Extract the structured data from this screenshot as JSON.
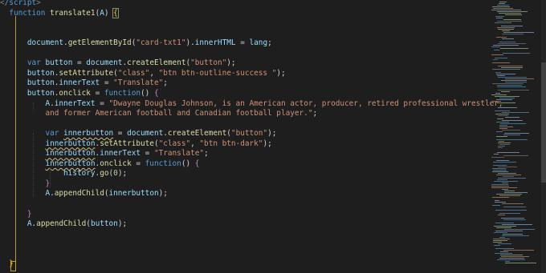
{
  "editor": {
    "lines": [
      {
        "tokens": [
          {
            "t": "<",
            "c": "t-tag"
          },
          {
            "t": "/script",
            "c": "t-tagname"
          },
          {
            "t": ">",
            "c": "t-tag"
          }
        ]
      },
      {
        "tokens": [
          {
            "t": "  "
          },
          {
            "t": "function",
            "c": "t-kw"
          },
          {
            "t": " "
          },
          {
            "t": "translate1",
            "c": "t-fn"
          },
          {
            "t": "(",
            "c": "t-punc"
          },
          {
            "t": "A",
            "c": "t-var"
          },
          {
            "t": ") "
          },
          {
            "t": "{",
            "c": "t-par1 bracket-box"
          }
        ]
      },
      {
        "tokens": []
      },
      {
        "tokens": []
      },
      {
        "tokens": [
          {
            "t": "      "
          },
          {
            "t": "document",
            "c": "t-obj"
          },
          {
            "t": "."
          },
          {
            "t": "getElementById",
            "c": "t-fn"
          },
          {
            "t": "("
          },
          {
            "t": "\"card-txt1\"",
            "c": "t-str"
          },
          {
            "t": ")."
          },
          {
            "t": "innerHTML",
            "c": "t-prop"
          },
          {
            "t": " = "
          },
          {
            "t": "lang",
            "c": "t-var"
          },
          {
            "t": ";"
          }
        ]
      },
      {
        "tokens": []
      },
      {
        "tokens": [
          {
            "t": "      "
          },
          {
            "t": "var",
            "c": "t-kw"
          },
          {
            "t": " "
          },
          {
            "t": "button",
            "c": "t-var"
          },
          {
            "t": " = "
          },
          {
            "t": "document",
            "c": "t-obj"
          },
          {
            "t": "."
          },
          {
            "t": "createElement",
            "c": "t-fn"
          },
          {
            "t": "("
          },
          {
            "t": "\"button\"",
            "c": "t-str"
          },
          {
            "t": ");"
          }
        ]
      },
      {
        "tokens": [
          {
            "t": "      "
          },
          {
            "t": "button",
            "c": "t-var"
          },
          {
            "t": "."
          },
          {
            "t": "setAttribute",
            "c": "t-fn"
          },
          {
            "t": "("
          },
          {
            "t": "\"class\"",
            "c": "t-str"
          },
          {
            "t": ", "
          },
          {
            "t": "\"btn btn-outline-success \"",
            "c": "t-str"
          },
          {
            "t": ");"
          }
        ]
      },
      {
        "tokens": [
          {
            "t": "      "
          },
          {
            "t": "button",
            "c": "t-var"
          },
          {
            "t": "."
          },
          {
            "t": "innerText",
            "c": "t-prop"
          },
          {
            "t": " = "
          },
          {
            "t": "\"Translate\"",
            "c": "t-str"
          },
          {
            "t": ";"
          }
        ]
      },
      {
        "tokens": [
          {
            "t": "      "
          },
          {
            "t": "button",
            "c": "t-var"
          },
          {
            "t": "."
          },
          {
            "t": "onclick",
            "c": "t-fn"
          },
          {
            "t": " = "
          },
          {
            "t": "function",
            "c": "t-kw"
          },
          {
            "t": "() "
          },
          {
            "t": "{",
            "c": "t-ctrl"
          }
        ]
      },
      {
        "tokens": [
          {
            "t": "          "
          },
          {
            "t": "A",
            "c": "t-var"
          },
          {
            "t": "."
          },
          {
            "t": "innerText",
            "c": "t-prop"
          },
          {
            "t": " = "
          },
          {
            "t": "\"Dwayne Douglas Johnson, is an American actor, producer, retired professional wrestler,",
            "c": "t-str"
          }
        ]
      },
      {
        "tokens": [
          {
            "t": "          "
          },
          {
            "t": "and former American football and Canadian football player.\"",
            "c": "t-str"
          },
          {
            "t": ";"
          }
        ]
      },
      {
        "tokens": []
      },
      {
        "tokens": [
          {
            "t": "          "
          },
          {
            "t": "var",
            "c": "t-kw"
          },
          {
            "t": " "
          },
          {
            "t": "innerbutton",
            "c": "t-var t-ul"
          },
          {
            "t": " = "
          },
          {
            "t": "document",
            "c": "t-obj"
          },
          {
            "t": "."
          },
          {
            "t": "createElement",
            "c": "t-fn"
          },
          {
            "t": "("
          },
          {
            "t": "\"button\"",
            "c": "t-str"
          },
          {
            "t": ");"
          }
        ]
      },
      {
        "tokens": [
          {
            "t": "          "
          },
          {
            "t": "innerbutton",
            "c": "t-var t-ul"
          },
          {
            "t": "."
          },
          {
            "t": "setAttribute",
            "c": "t-fn"
          },
          {
            "t": "("
          },
          {
            "t": "\"class\"",
            "c": "t-str"
          },
          {
            "t": ", "
          },
          {
            "t": "\"btn btn-dark\"",
            "c": "t-str"
          },
          {
            "t": ");"
          }
        ]
      },
      {
        "tokens": [
          {
            "t": "          "
          },
          {
            "t": "innerbutton",
            "c": "t-var t-ul"
          },
          {
            "t": "."
          },
          {
            "t": "innerText",
            "c": "t-prop"
          },
          {
            "t": " = "
          },
          {
            "t": "\"Translate\"",
            "c": "t-str"
          },
          {
            "t": ";"
          }
        ]
      },
      {
        "tokens": [
          {
            "t": "          "
          },
          {
            "t": "innerbutton",
            "c": "t-var t-ul"
          },
          {
            "t": "."
          },
          {
            "t": "onclick",
            "c": "t-fn"
          },
          {
            "t": " = "
          },
          {
            "t": "function",
            "c": "t-kw"
          },
          {
            "t": "() "
          },
          {
            "t": "{",
            "c": "t-ctrl"
          }
        ]
      },
      {
        "tokens": [
          {
            "t": "              "
          },
          {
            "t": "history",
            "c": "t-obj"
          },
          {
            "t": "."
          },
          {
            "t": "go",
            "c": "t-fn"
          },
          {
            "t": "("
          },
          {
            "t": "0",
            "c": "t-num"
          },
          {
            "t": ");"
          }
        ]
      },
      {
        "tokens": [
          {
            "t": "          "
          },
          {
            "t": "}",
            "c": "t-ctrl"
          }
        ]
      },
      {
        "tokens": [
          {
            "t": "          "
          },
          {
            "t": "A",
            "c": "t-var"
          },
          {
            "t": "."
          },
          {
            "t": "appendChild",
            "c": "t-fn"
          },
          {
            "t": "("
          },
          {
            "t": "innerbutton",
            "c": "t-var"
          },
          {
            "t": ");"
          }
        ]
      },
      {
        "tokens": []
      },
      {
        "tokens": [
          {
            "t": "      "
          },
          {
            "t": "}",
            "c": "t-ctrl"
          }
        ]
      },
      {
        "tokens": [
          {
            "t": "      "
          },
          {
            "t": "A",
            "c": "t-var"
          },
          {
            "t": "."
          },
          {
            "t": "appendChild",
            "c": "t-fn"
          },
          {
            "t": "("
          },
          {
            "t": "button",
            "c": "t-var"
          },
          {
            "t": ");"
          }
        ]
      },
      {
        "tokens": []
      },
      {
        "tokens": []
      },
      {
        "tokens": []
      },
      {
        "tokens": [
          {
            "t": "  "
          },
          {
            "t": "}",
            "c": "t-par1"
          }
        ]
      }
    ]
  },
  "colors": {
    "background": "#1e1e1e",
    "keyword": "#569cd6",
    "function": "#dcdcaa",
    "variable": "#9cdcfe",
    "string": "#ce9178",
    "number": "#b5cea8",
    "bracket": "#ffd700"
  }
}
